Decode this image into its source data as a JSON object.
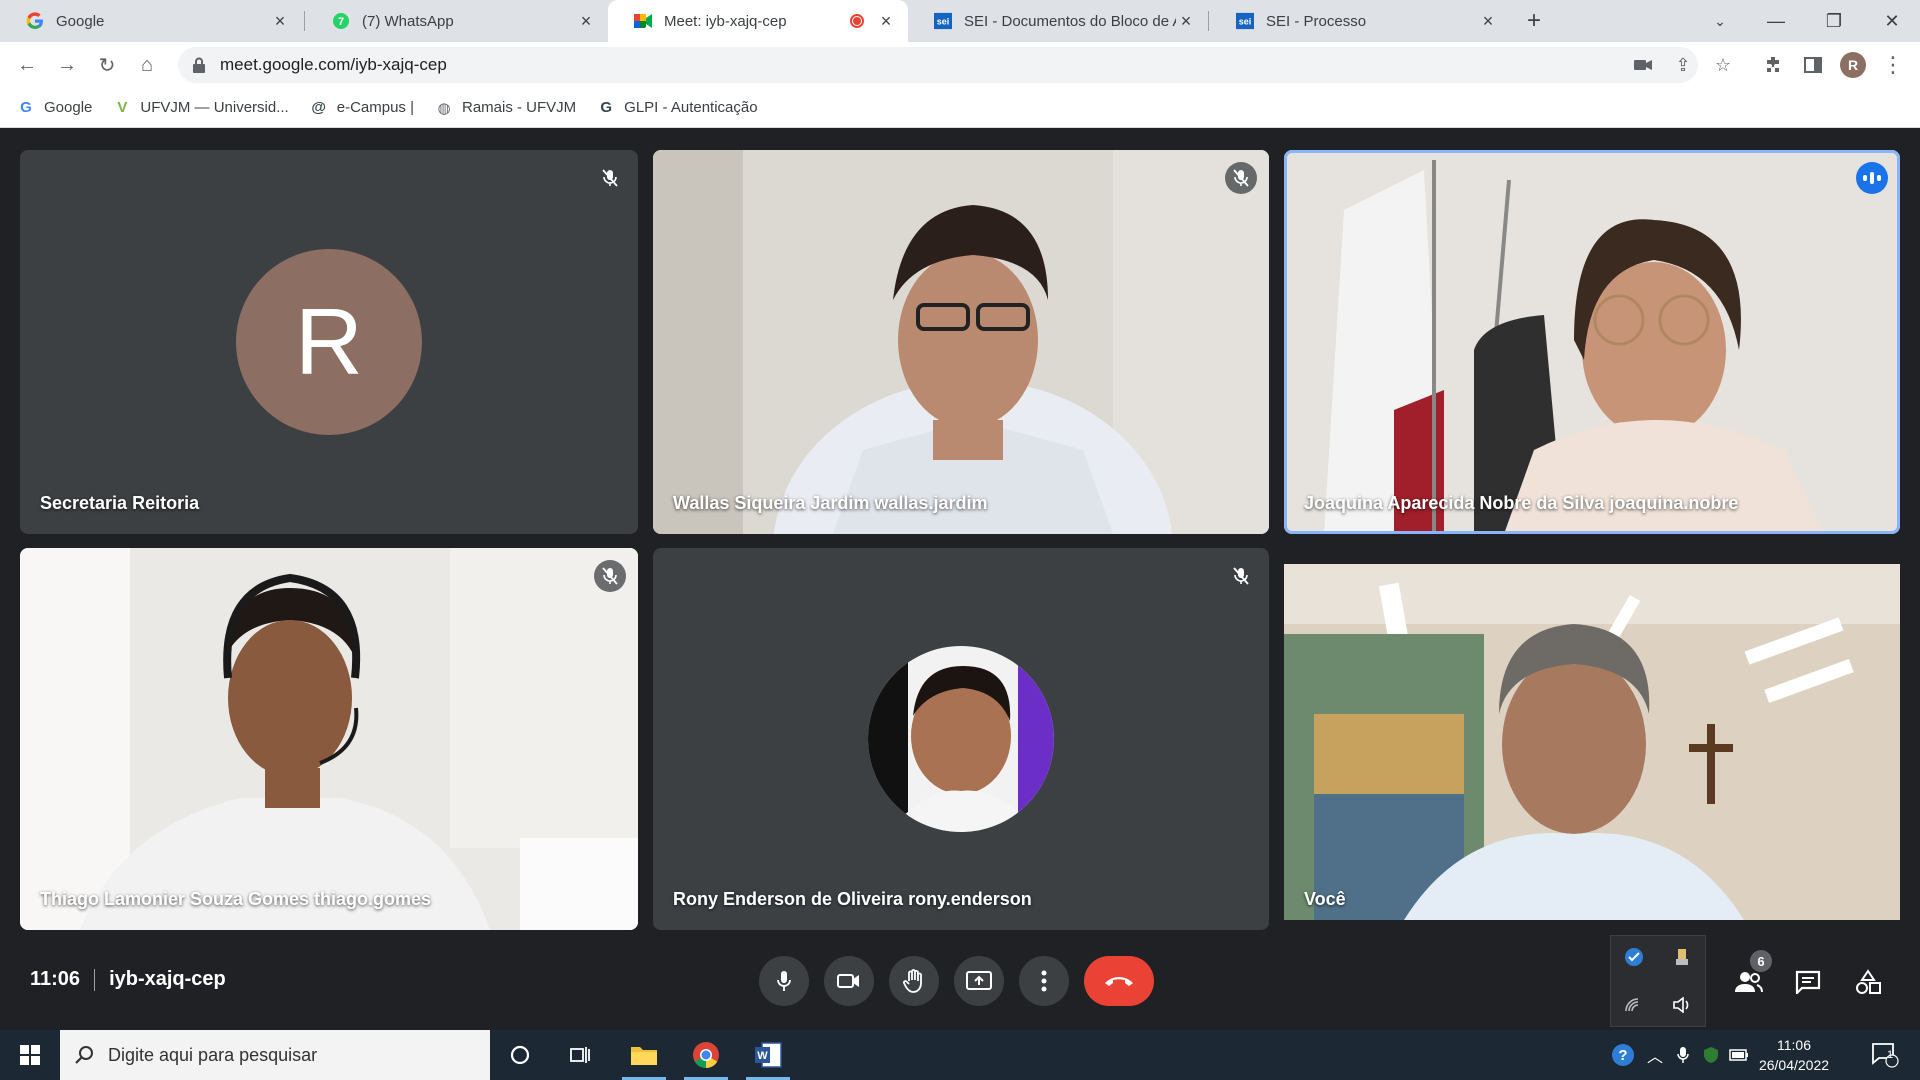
{
  "browser": {
    "tabs": [
      {
        "title": "Google",
        "icon": "google-icon",
        "active": false
      },
      {
        "title": "(7) WhatsApp",
        "icon": "whatsapp-icon",
        "active": false
      },
      {
        "title": "Meet: iyb-xajq-cep",
        "icon": "meet-icon",
        "active": true,
        "recording": true
      },
      {
        "title": "SEI - Documentos do Bloco de A",
        "icon": "sei-icon",
        "active": false
      },
      {
        "title": "SEI - Processo",
        "icon": "sei-icon",
        "active": false
      }
    ],
    "new_tab": "+",
    "url": "meet.google.com/iyb-xajq-cep",
    "profile_initial": "R",
    "bookmarks": [
      {
        "label": "Google",
        "icon": "google-icon"
      },
      {
        "label": "UFVJM — Universid...",
        "icon": "ufvjm-icon"
      },
      {
        "label": "e-Campus |",
        "icon": "ecampus-icon"
      },
      {
        "label": "Ramais - UFVJM",
        "icon": "globe-icon"
      },
      {
        "label": "GLPI - Autenticação",
        "icon": "glpi-icon"
      }
    ]
  },
  "meet": {
    "participants": [
      {
        "name": "Secretaria Reitoria",
        "type": "avatar",
        "initial": "R",
        "muted": true,
        "speaking": false
      },
      {
        "name": "Wallas Siqueira Jardim wallas.jardim",
        "type": "video",
        "muted": true,
        "speaking": false
      },
      {
        "name": "Joaquina Aparecida Nobre da Silva joaquina.nobre",
        "type": "video",
        "muted": false,
        "speaking": true
      },
      {
        "name": "Thiago Lamonier Souza Gomes thiago.gomes",
        "type": "video",
        "muted": true,
        "speaking": false
      },
      {
        "name": "Rony Enderson de Oliveira rony.enderson",
        "type": "photo-avatar",
        "muted": true,
        "speaking": false
      },
      {
        "name": "Você",
        "type": "video",
        "muted": false,
        "speaking": false
      }
    ],
    "time": "11:06",
    "meeting_code": "iyb-xajq-cep",
    "participant_count": "6",
    "colors": {
      "accent": "#8ab4f8",
      "end_call": "#ea4335",
      "avatar_bg": "#8d6e63",
      "tile_bg": "#3c4043"
    }
  },
  "taskbar": {
    "search_placeholder": "Digite aqui para pesquisar",
    "time": "11:06",
    "date": "26/04/2022",
    "notification_count": "1"
  }
}
